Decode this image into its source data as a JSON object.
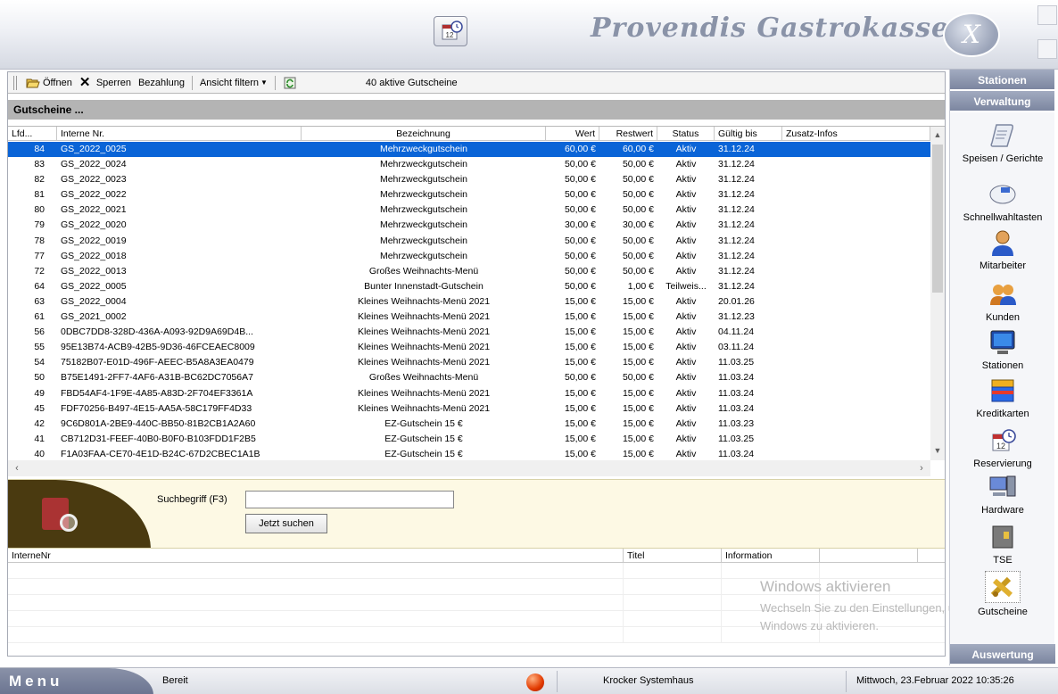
{
  "header": {
    "brand": "Provendis Gastrokasse",
    "logo_letter": "X"
  },
  "toolbar": {
    "open_label": "Öffnen",
    "lock_label": "Sperren",
    "payment_label": "Bezahlung",
    "filter_label": "Ansicht filtern",
    "count_label": "40  aktive Gutscheine"
  },
  "section": {
    "title": "Gutscheine ..."
  },
  "grid": {
    "headers": [
      "Lfd...",
      "Interne Nr.",
      "Bezeichnung",
      "Wert",
      "Restwert",
      "Status",
      "Gültig bis",
      "Zusatz-Infos"
    ],
    "rows": [
      [
        "84",
        "GS_2022_0025",
        "Mehrzweckgutschein",
        "60,00 €",
        "60,00 €",
        "Aktiv",
        "31.12.24",
        ""
      ],
      [
        "83",
        "GS_2022_0024",
        "Mehrzweckgutschein",
        "50,00 €",
        "50,00 €",
        "Aktiv",
        "31.12.24",
        ""
      ],
      [
        "82",
        "GS_2022_0023",
        "Mehrzweckgutschein",
        "50,00 €",
        "50,00 €",
        "Aktiv",
        "31.12.24",
        ""
      ],
      [
        "81",
        "GS_2022_0022",
        "Mehrzweckgutschein",
        "50,00 €",
        "50,00 €",
        "Aktiv",
        "31.12.24",
        ""
      ],
      [
        "80",
        "GS_2022_0021",
        "Mehrzweckgutschein",
        "50,00 €",
        "50,00 €",
        "Aktiv",
        "31.12.24",
        ""
      ],
      [
        "79",
        "GS_2022_0020",
        "Mehrzweckgutschein",
        "30,00 €",
        "30,00 €",
        "Aktiv",
        "31.12.24",
        ""
      ],
      [
        "78",
        "GS_2022_0019",
        "Mehrzweckgutschein",
        "50,00 €",
        "50,00 €",
        "Aktiv",
        "31.12.24",
        ""
      ],
      [
        "77",
        "GS_2022_0018",
        "Mehrzweckgutschein",
        "50,00 €",
        "50,00 €",
        "Aktiv",
        "31.12.24",
        ""
      ],
      [
        "72",
        "GS_2022_0013",
        "Großes Weihnachts-Menü",
        "50,00 €",
        "50,00 €",
        "Aktiv",
        "31.12.24",
        ""
      ],
      [
        "64",
        "GS_2022_0005",
        "Bunter Innenstadt-Gutschein",
        "50,00 €",
        "1,00 €",
        "Teilweis...",
        "31.12.24",
        ""
      ],
      [
        "63",
        "GS_2022_0004",
        "Kleines Weihnachts-Menü 2021",
        "15,00 €",
        "15,00 €",
        "Aktiv",
        "20.01.26",
        ""
      ],
      [
        "61",
        "GS_2021_0002",
        "Kleines Weihnachts-Menü 2021",
        "15,00 €",
        "15,00 €",
        "Aktiv",
        "31.12.23",
        ""
      ],
      [
        "56",
        "0DBC7DD8-328D-436A-A093-92D9A69D4B...",
        "Kleines Weihnachts-Menü 2021",
        "15,00 €",
        "15,00 €",
        "Aktiv",
        "04.11.24",
        ""
      ],
      [
        "55",
        "95E13B74-ACB9-42B5-9D36-46FCEAEC8009",
        "Kleines Weihnachts-Menü 2021",
        "15,00 €",
        "15,00 €",
        "Aktiv",
        "03.11.24",
        ""
      ],
      [
        "54",
        "75182B07-E01D-496F-AEEC-B5A8A3EA0479",
        "Kleines Weihnachts-Menü 2021",
        "15,00 €",
        "15,00 €",
        "Aktiv",
        "11.03.25",
        ""
      ],
      [
        "50",
        "B75E1491-2FF7-4AF6-A31B-BC62DC7056A7",
        "Großes Weihnachts-Menü",
        "50,00 €",
        "50,00 €",
        "Aktiv",
        "11.03.24",
        ""
      ],
      [
        "49",
        "FBD54AF4-1F9E-4A85-A83D-2F704EF3361A",
        "Kleines Weihnachts-Menü 2021",
        "15,00 €",
        "15,00 €",
        "Aktiv",
        "11.03.24",
        ""
      ],
      [
        "45",
        "FDF70256-B497-4E15-AA5A-58C179FF4D33",
        "Kleines Weihnachts-Menü 2021",
        "15,00 €",
        "15,00 €",
        "Aktiv",
        "11.03.24",
        ""
      ],
      [
        "42",
        "9C6D801A-2BE9-440C-BB50-81B2CB1A2A60",
        "EZ-Gutschein 15 €",
        "15,00 €",
        "15,00 €",
        "Aktiv",
        "11.03.23",
        ""
      ],
      [
        "41",
        "CB712D31-FEEF-40B0-B0F0-B103FDD1F2B5",
        "EZ-Gutschein 15 €",
        "15,00 €",
        "15,00 €",
        "Aktiv",
        "11.03.25",
        ""
      ],
      [
        "40",
        "F1A03FAA-CE70-4E1D-B24C-67D2CBEC1A1B",
        "EZ-Gutschein 15 €",
        "15,00 €",
        "15,00 €",
        "Aktiv",
        "11.03.24",
        ""
      ]
    ]
  },
  "search": {
    "label": "Suchbegriff (F3)",
    "value": "",
    "button_label": "Jetzt suchen"
  },
  "results": {
    "headers": [
      "InterneNr",
      "Titel",
      "Information",
      ""
    ]
  },
  "watermark": {
    "title": "Windows aktivieren",
    "line1": "Wechseln Sie zu den Einstellungen, um",
    "line2": "Windows zu aktivieren."
  },
  "sidebar": {
    "stations_header": "Stationen",
    "admin_header": "Verwaltung",
    "eval_header": "Auswertung",
    "items": [
      {
        "label": "Speisen / Gerichte",
        "icon": "scroll-icon"
      },
      {
        "label": "Schnellwahltasten",
        "icon": "keyboard-icon"
      },
      {
        "label": "Mitarbeiter",
        "icon": "person-icon"
      },
      {
        "label": "Kunden",
        "icon": "customers-icon"
      },
      {
        "label": "Stationen",
        "icon": "monitor-icon"
      },
      {
        "label": "Kreditkarten",
        "icon": "credit-card-icon"
      },
      {
        "label": "Reservierung",
        "icon": "calendar-clock-icon"
      },
      {
        "label": "Hardware",
        "icon": "computer-icon"
      },
      {
        "label": "TSE",
        "icon": "tse-device-icon"
      },
      {
        "label": "Gutscheine",
        "icon": "voucher-icon"
      }
    ]
  },
  "status": {
    "menu_label": "Menu",
    "state": "Bereit",
    "company": "Krocker Systemhaus",
    "datetime": "Mittwoch, 23.Februar 2022 10:35:26"
  },
  "colors": {
    "selection": "#0a64d7",
    "sidebar_header": "#7c86a0",
    "status_dot": "#e23a00"
  }
}
